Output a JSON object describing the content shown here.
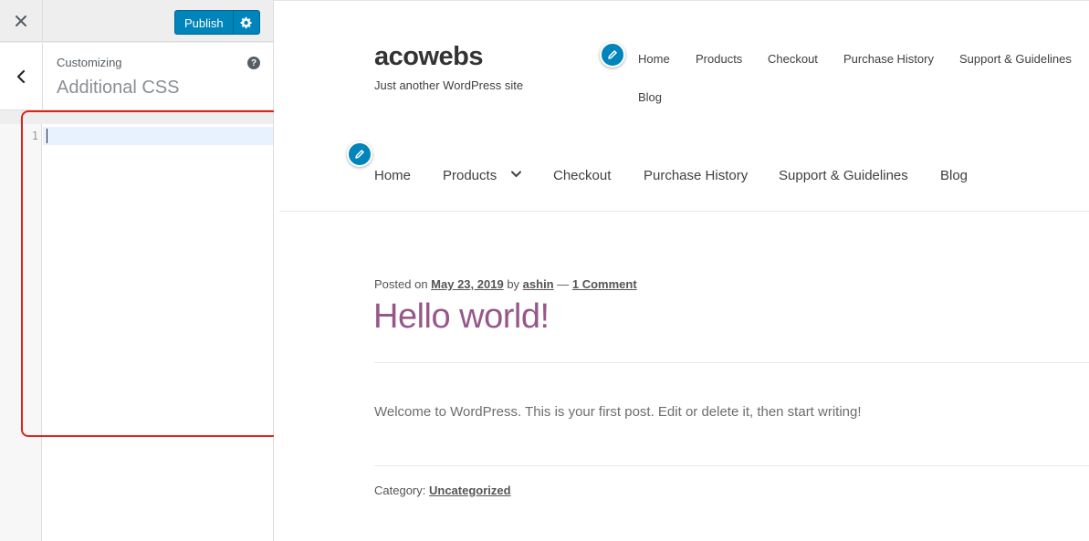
{
  "sidebar": {
    "close_icon": "close-icon",
    "publish_label": "Publish",
    "settings_icon": "gear-icon",
    "back_icon": "chevron-left-icon",
    "customizing_label": "Customizing",
    "section_title": "Additional CSS",
    "help_icon": "question-icon",
    "editor": {
      "line_number": "1",
      "value": ""
    },
    "highlight_color": "#e0201a"
  },
  "preview": {
    "site_title": "acowebs",
    "site_description": "Just another WordPress site",
    "edit_icon": "pencil-icon",
    "secondary_nav": [
      "Home",
      "Products",
      "Checkout",
      "Purchase History",
      "Support & Guidelines",
      "Blog"
    ],
    "primary_nav": [
      "Home",
      "Products",
      "Checkout",
      "Purchase History",
      "Support & Guidelines",
      "Blog"
    ],
    "post": {
      "posted_on_label": "Posted on",
      "date": "May 23, 2019",
      "by_label": "by",
      "author": "ashin",
      "separator": "—",
      "comments": "1 Comment",
      "title": "Hello world!",
      "body": "Welcome to WordPress. This is your first post. Edit or delete it, then start writing!",
      "category_label": "Category:",
      "category": "Uncategorized"
    },
    "colors": {
      "accent": "#0085ba",
      "post_title": "#96588a"
    }
  }
}
